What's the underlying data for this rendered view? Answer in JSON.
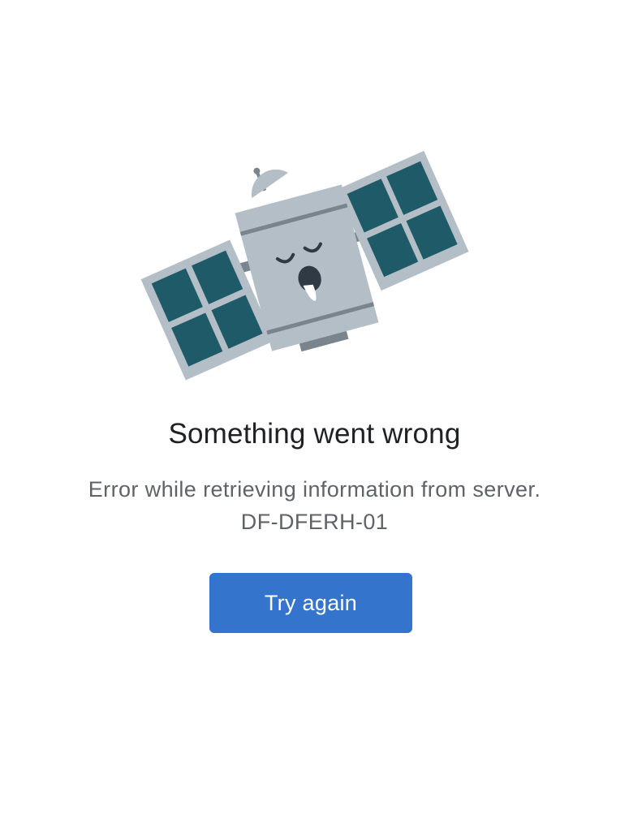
{
  "error_screen": {
    "illustration": "sleeping-satellite",
    "title": "Something went wrong",
    "message": "Error while retrieving information from server.",
    "error_code": "DF-DFERH-01",
    "retry_label": "Try again"
  },
  "colors": {
    "title_text": "#202124",
    "body_text": "#5f6368",
    "button_background": "#3474cc",
    "button_text": "#ffffff",
    "satellite_body": "#b3bec6",
    "satellite_band": "#7a848c",
    "solar_frame": "#b3bec6",
    "solar_cells": "#1f5a69"
  }
}
